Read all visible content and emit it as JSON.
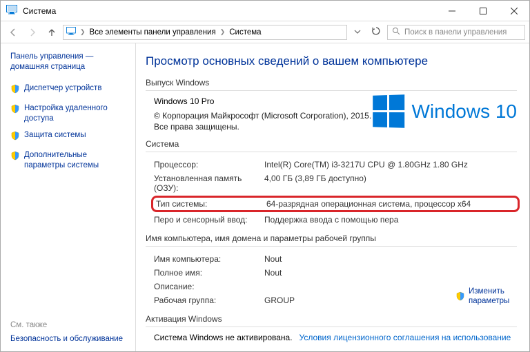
{
  "window": {
    "title": "Система"
  },
  "breadcrumb": {
    "item1": "Все элементы панели управления",
    "item2": "Система"
  },
  "search": {
    "placeholder": "Поиск в панели управления"
  },
  "sidebar": {
    "home": "Панель управления — домашняя страница",
    "items": [
      "Диспетчер устройств",
      "Настройка удаленного доступа",
      "Защита системы",
      "Дополнительные параметры системы"
    ],
    "see_also_hdr": "См. также",
    "see_also_link": "Безопасность и обслуживание"
  },
  "main": {
    "page_title": "Просмотр основных сведений о вашем компьютере",
    "sec_edition": "Выпуск Windows",
    "edition_name": "Windows 10 Pro",
    "copyright": "© Корпорация Майкрософт (Microsoft Corporation), 2015. Все права защищены.",
    "winlogo_text": "Windows 10",
    "sec_system": "Система",
    "sys_rows": {
      "cpu_k": "Процессор:",
      "cpu_v": "Intel(R) Core(TM) i3-3217U CPU @ 1.80GHz   1.80 GHz",
      "ram_k": "Установленная память (ОЗУ):",
      "ram_v": "4,00 ГБ (3,89 ГБ доступно)",
      "type_k": "Тип системы:",
      "type_v": "64-разрядная операционная система, процессор x64",
      "pen_k": "Перо и сенсорный ввод:",
      "pen_v": "Поддержка ввода с помощью пера"
    },
    "sec_domain": "Имя компьютера, имя домена и параметры рабочей группы",
    "dom_rows": {
      "comp_k": "Имя компьютера:",
      "comp_v": "Nout",
      "full_k": "Полное имя:",
      "full_v": "Nout",
      "desc_k": "Описание:",
      "desc_v": "",
      "wg_k": "Рабочая группа:",
      "wg_v": "GROUP"
    },
    "change_link": "Изменить параметры",
    "sec_activation": "Активация Windows",
    "act_text": "Система Windows не активирована.",
    "act_link": "Условия лицензионного соглашения на использование"
  }
}
